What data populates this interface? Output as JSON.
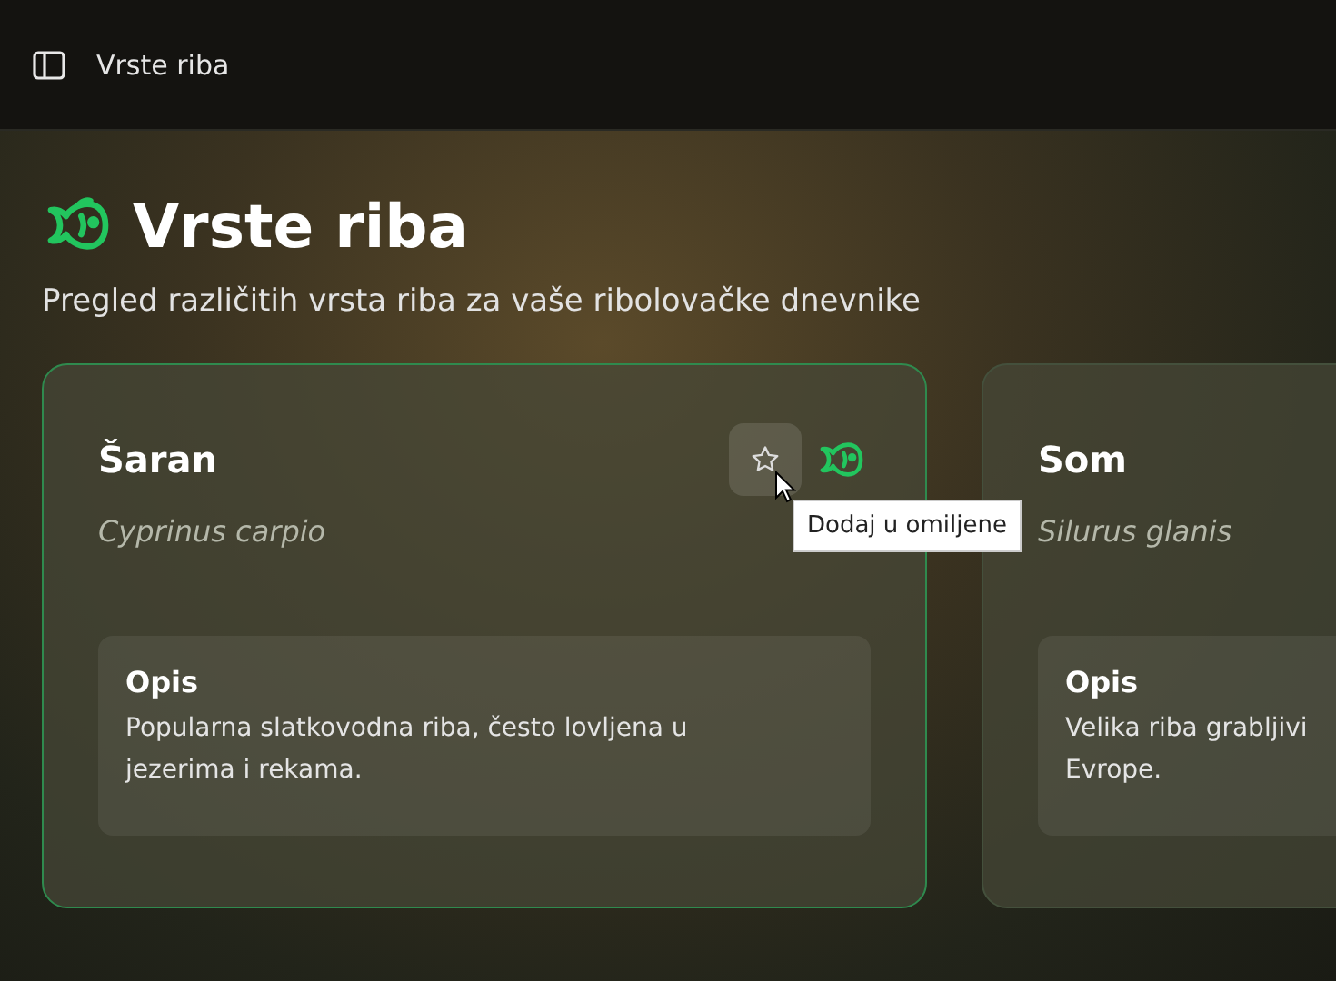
{
  "top_bar": {
    "title": "Vrste riba"
  },
  "header": {
    "title": "Vrste riba",
    "subtitle": "Pregled različitih vrsta riba za vaše ribolovačke dnevnike"
  },
  "cards": [
    {
      "name": "Šaran",
      "latin": "Cyprinus carpio",
      "selected": true,
      "favorite": false,
      "tooltip": "Dodaj u omiljene",
      "section_title": "Opis",
      "description": "Popularna slatkovodna riba, često lovljena u\njezerima i rekama."
    },
    {
      "name": "Som",
      "latin": "Silurus glanis",
      "selected": false,
      "section_title": "Opis",
      "description": "Velika riba grabljivi\nEvrope."
    }
  ]
}
